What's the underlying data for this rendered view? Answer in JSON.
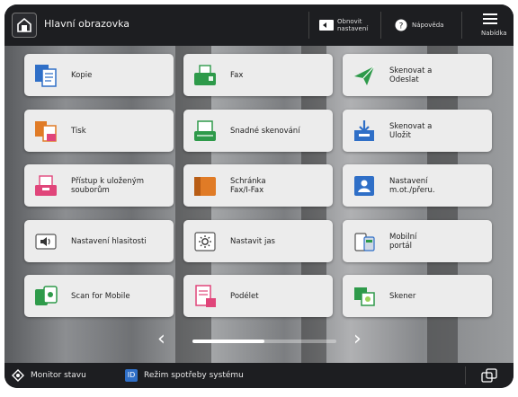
{
  "header": {
    "title": "Hlavní obrazovka",
    "reset_label": "Obnovit\nnastavení",
    "help_label": "Nápověda",
    "menu_label": "Nabídka"
  },
  "tiles": [
    {
      "label": "Kopie",
      "icon": "copy-icon"
    },
    {
      "label": "Fax",
      "icon": "fax-icon"
    },
    {
      "label": "Skenovat a\nOdeslat",
      "icon": "scan-send-icon"
    },
    {
      "label": "Tisk",
      "icon": "print-icon"
    },
    {
      "label": "Snadné skenování",
      "icon": "easy-scan-icon"
    },
    {
      "label": "Skenovat a\nUložit",
      "icon": "scan-save-icon"
    },
    {
      "label": "Přístup k uloženým\nsouborům",
      "icon": "stored-files-icon"
    },
    {
      "label": "Schránka\nFax/I-Fax",
      "icon": "fax-inbox-icon"
    },
    {
      "label": "Nastavení\nm.ot./přeru.",
      "icon": "settings-icon"
    },
    {
      "label": "Nastavení hlasitosti",
      "icon": "volume-icon"
    },
    {
      "label": "Nastavit jas",
      "icon": "brightness-icon"
    },
    {
      "label": "Mobilní\nportál",
      "icon": "mobile-portal-icon"
    },
    {
      "label": "Scan for Mobile",
      "icon": "scan-mobile-icon"
    },
    {
      "label": "Podélet",
      "icon": "document-icon"
    },
    {
      "label": "Skener",
      "icon": "scanner-icon"
    }
  ],
  "pagination": {
    "current_page_fraction": 0.5
  },
  "footer": {
    "status_label": "Monitor stavu",
    "mode_label": "Režim spotřeby systému"
  },
  "colors": {
    "bar": "#1d1e21",
    "tile": "#ececec",
    "accent_blue": "#2f6fc7",
    "accent_green": "#2e9a4a",
    "accent_orange": "#e07b26",
    "accent_pink": "#e0457a"
  }
}
